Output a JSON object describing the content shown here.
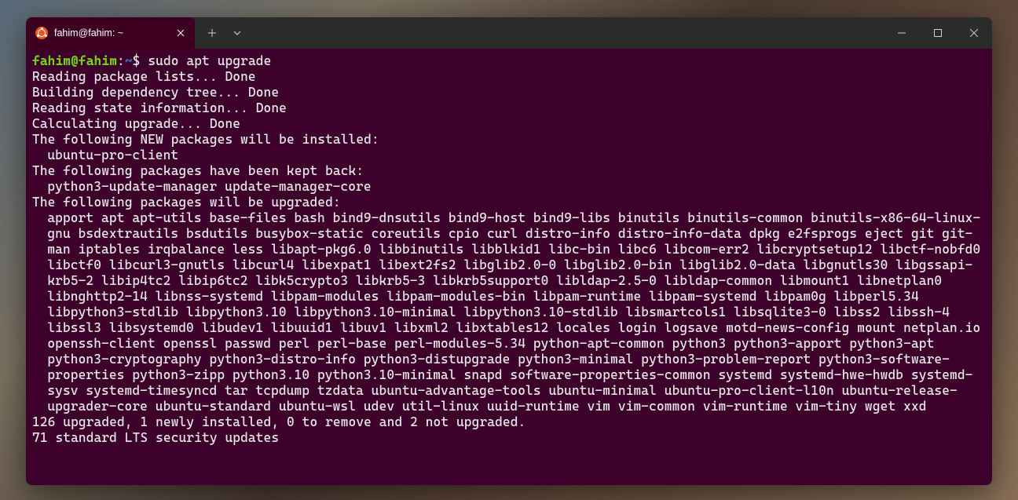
{
  "tab": {
    "title": "fahim@fahim: ~",
    "icon_name": "ubuntu-logo"
  },
  "prompt": {
    "user": "fahim",
    "at": "@",
    "host": "fahim",
    "colon": ":",
    "path": "~",
    "symbol": "$"
  },
  "command": "sudo apt upgrade",
  "lines": {
    "l1": "Reading package lists... Done",
    "l2": "Building dependency tree... Done",
    "l3": "Reading state information... Done",
    "l4": "Calculating upgrade... Done",
    "l5": "The following NEW packages will be installed:",
    "l6": "ubuntu-pro-client",
    "l7": "The following packages have been kept back:",
    "l8": "python3-update-manager update-manager-core",
    "l9": "The following packages will be upgraded:",
    "l10": "apport apt apt-utils base-files bash bind9-dnsutils bind9-host bind9-libs binutils binutils-common binutils-x86-64-linux-gnu bsdextrautils bsdutils busybox-static coreutils cpio curl distro-info distro-info-data dpkg e2fsprogs eject git git-man iptables irqbalance less libapt-pkg6.0 libbinutils libblkid1 libc-bin libc6 libcom-err2 libcryptsetup12 libctf-nobfd0 libctf0 libcurl3-gnutls libcurl4 libexpat1 libext2fs2 libglib2.0-0 libglib2.0-bin libglib2.0-data libgnutls30 libgssapi-krb5-2 libip4tc2 libip6tc2 libk5crypto3 libkrb5-3 libkrb5support0 libldap-2.5-0 libldap-common libmount1 libnetplan0 libnghttp2-14 libnss-systemd libpam-modules libpam-modules-bin libpam-runtime libpam-systemd libpam0g libperl5.34 libpython3-stdlib libpython3.10 libpython3.10-minimal libpython3.10-stdlib libsmartcols1 libsqlite3-0 libss2 libssh-4 libssl3 libsystemd0 libudev1 libuuid1 libuv1 libxml2 libxtables12 locales login logsave motd-news-config mount netplan.io openssh-client openssl passwd perl perl-base perl-modules-5.34 python-apt-common python3 python3-apport python3-apt python3-cryptography python3-distro-info python3-distupgrade python3-minimal python3-problem-report python3-software-properties python3-zipp python3.10 python3.10-minimal snapd software-properties-common systemd systemd-hwe-hwdb systemd-sysv systemd-timesyncd tar tcpdump tzdata ubuntu-advantage-tools ubuntu-minimal ubuntu-pro-client-l10n ubuntu-release-upgrader-core ubuntu-standard ubuntu-wsl udev util-linux uuid-runtime vim vim-common vim-runtime vim-tiny wget xxd",
    "l11": "126 upgraded, 1 newly installed, 0 to remove and 2 not upgraded.",
    "l12": "71 standard LTS security updates"
  }
}
